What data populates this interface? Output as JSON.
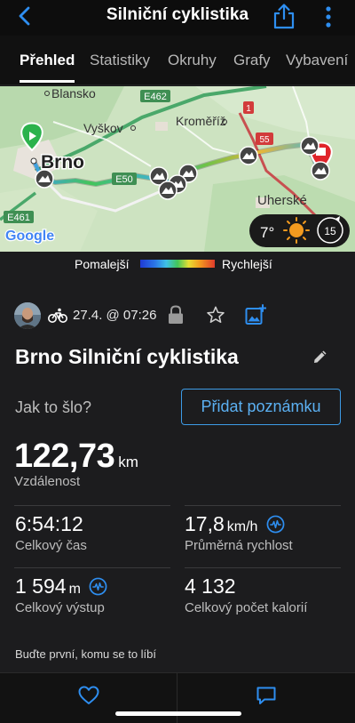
{
  "header": {
    "title": "Silniční cyklistika"
  },
  "tabs": [
    {
      "label": "Přehled"
    },
    {
      "label": "Statistiky"
    },
    {
      "label": "Okruhy"
    },
    {
      "label": "Grafy"
    },
    {
      "label": "Vybavení"
    }
  ],
  "map": {
    "places": {
      "blansko": "Blansko",
      "vyskov": "Vyškov",
      "kromeriz": "Kroměříž",
      "brno": "Brno",
      "uherske": "Uherské"
    },
    "roads": {
      "e462": "E462",
      "e50": "E50",
      "e461": "E461",
      "r1": "1",
      "r55": "55"
    },
    "provider": "Google",
    "weather": {
      "temperature": "7°",
      "wind": "15"
    }
  },
  "legend": {
    "slow": "Pomalejší",
    "fast": "Rychlejší"
  },
  "activity": {
    "date": "27.4. @ 07:26",
    "title": "Brno Silniční cyklistika",
    "how_prompt": "Jak to šlo?",
    "add_note": "Přidat poznámku"
  },
  "stats": {
    "distance": {
      "value": "122,73",
      "unit": "km",
      "label": "Vzdálenost"
    },
    "total_time": {
      "value": "6:54:12",
      "label": "Celkový čas"
    },
    "avg_speed": {
      "value": "17,8",
      "unit": "km/h",
      "label": "Průměrná rychlost"
    },
    "ascent": {
      "value": "1 594",
      "unit": "m",
      "label": "Celkový výstup"
    },
    "calories": {
      "value": "4 132",
      "label": "Celkový počet kalorií"
    }
  },
  "likes_text": "Buďte první, komu se to líbí",
  "colors": {
    "accent": "#3d9be6",
    "background": "#1c1c1e",
    "start_marker": "#2bb24c",
    "finish_marker": "#e0242a"
  }
}
